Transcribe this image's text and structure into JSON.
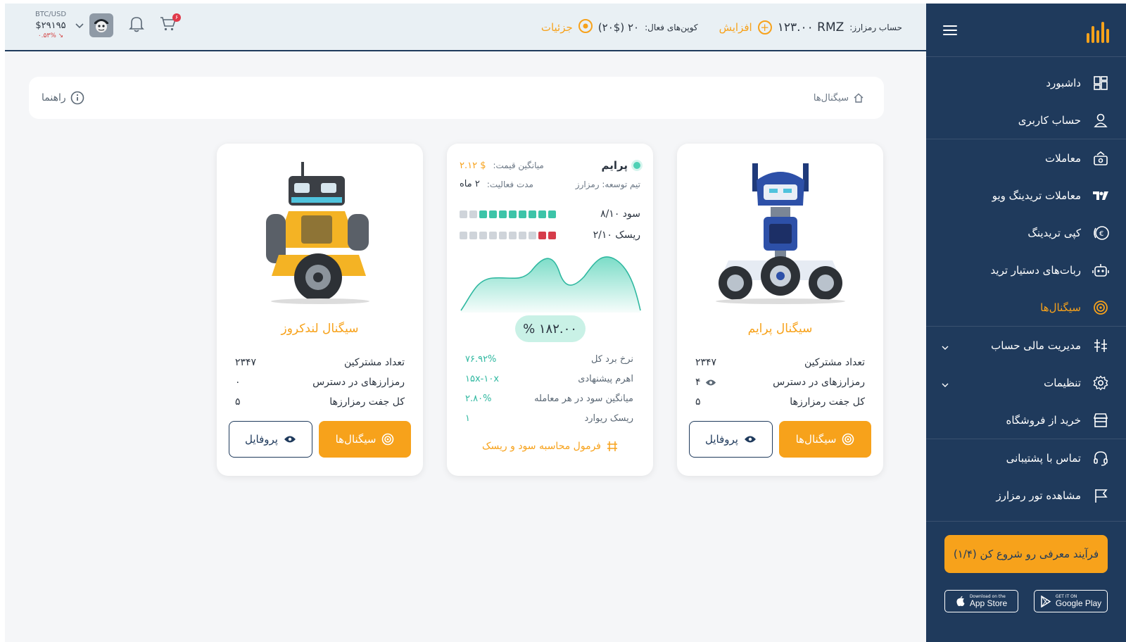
{
  "header": {
    "account_label": "حساب رمزارز:",
    "account_value": "۱۲۳.۰۰ RMZ",
    "increase_label": "افزایش",
    "coupons_label": "کوپن‌های فعال:",
    "coupons_value": "۲۰ (۲۰$)",
    "details_label": "جزئیات",
    "ticker_pair": "BTC/USD",
    "ticker_price": "$۲۹۱۹۵",
    "ticker_change": "۰.۵۳%",
    "cart_badge": "۶"
  },
  "breadcrumb": {
    "current": "سیگنال‌ها",
    "help_label": "راهنما"
  },
  "sidebar": {
    "items": [
      {
        "label": "داشبورد",
        "icon": "dashboard-icon"
      },
      {
        "label": "حساب کاربری",
        "icon": "user-icon"
      },
      {
        "label": "معاملات",
        "icon": "trades-icon"
      },
      {
        "label": "معاملات تریدینگ ویو",
        "icon": "tradingview-icon"
      },
      {
        "label": "کپی تریدینگ",
        "icon": "copy-trading-icon"
      },
      {
        "label": "ربات‌های دستیار ترید",
        "icon": "robot-icon"
      },
      {
        "label": "سیگنال‌ها",
        "icon": "signal-icon",
        "active": true
      },
      {
        "label": "مدیریت مالی حساب",
        "icon": "finance-icon"
      },
      {
        "label": "تنظیمات",
        "icon": "settings-icon"
      },
      {
        "label": "خرید از فروشگاه",
        "icon": "store-icon"
      },
      {
        "label": "تماس با پشتیبانی",
        "icon": "headset-icon"
      },
      {
        "label": "مشاهده تور رمزارز",
        "icon": "flag-icon"
      }
    ],
    "cta": "فرآیند معرفی رو شروع کن (۱/۴)",
    "app_store": {
      "small": "Download on the",
      "big": "App Store"
    },
    "google_play": {
      "small": "GET IT ON",
      "big": "Google Play"
    }
  },
  "cards": {
    "right": {
      "title": "سیگنال پرایم",
      "rows": [
        {
          "label": "تعداد مشترکین",
          "value": "۲۳۴۷"
        },
        {
          "label": "رمزارزهای در دسترس",
          "value": "۴"
        },
        {
          "label": "کل جفت رمزارزها",
          "value": "۵"
        }
      ],
      "primary_btn": "سیگنال‌ها",
      "outline_btn": "پروفایل"
    },
    "middle": {
      "name": "پرایم",
      "avg_price_label": "میانگین قیمت:",
      "avg_price_value": "۲.۱۲ $",
      "dev_team": "تیم توسعه: رمزارز",
      "duration_label": "مدت فعالیت:",
      "duration_value": "۲ ماه",
      "profit_label": "سود ۸/۱۰",
      "profit_score": 8,
      "risk_label": "ریسک ۲/۱۰",
      "risk_score": 2,
      "return_pct": "۱۸۲.۰۰ %",
      "rows": [
        {
          "label": "نرخ برد کل",
          "value": "۷۶.۹۲%"
        },
        {
          "label": "اهرم پیشنهادی",
          "value": "۱۵x-۱۰x"
        },
        {
          "label": "میانگین سود در هر معامله",
          "value": "۲.۸۰%"
        },
        {
          "label": "ریسک ریوارد",
          "value": "۱"
        }
      ],
      "formula_label": "فرمول محاسبه سود و ریسک"
    },
    "left": {
      "title": "سیگنال لندکروز",
      "rows": [
        {
          "label": "تعداد مشترکین",
          "value": "۲۳۴۷"
        },
        {
          "label": "رمزارزهای در دسترس",
          "value": "۰"
        },
        {
          "label": "کل جفت رمزارزها",
          "value": "۵"
        }
      ],
      "primary_btn": "سیگنال‌ها",
      "outline_btn": "پروفایل"
    }
  },
  "colors": {
    "accent": "#f7a21b",
    "navy": "#1f3a5c",
    "teal": "#3cc4a8",
    "risk": "#d63c4a"
  }
}
